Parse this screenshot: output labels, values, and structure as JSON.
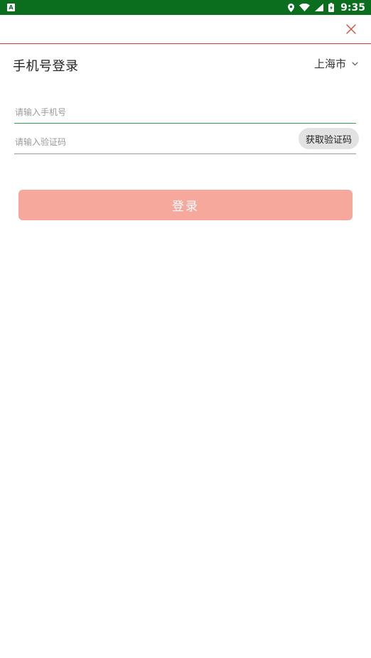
{
  "status_bar": {
    "time": "9:35",
    "notification_icon": "a-box-icon",
    "icons": [
      "location-icon",
      "wifi-icon",
      "signal-icon",
      "battery-icon"
    ]
  },
  "header": {
    "close_icon": "close-icon"
  },
  "login": {
    "title": "手机号登录",
    "city": "上海市",
    "phone_placeholder": "请输入手机号",
    "code_placeholder": "请输入验证码",
    "get_code_label": "获取验证码",
    "submit_label": "登录"
  },
  "colors": {
    "status_bar": "#0a6e1e",
    "accent_red": "#c8412f",
    "focus_green": "#3aa64a",
    "login_button": "#f7a89d"
  }
}
